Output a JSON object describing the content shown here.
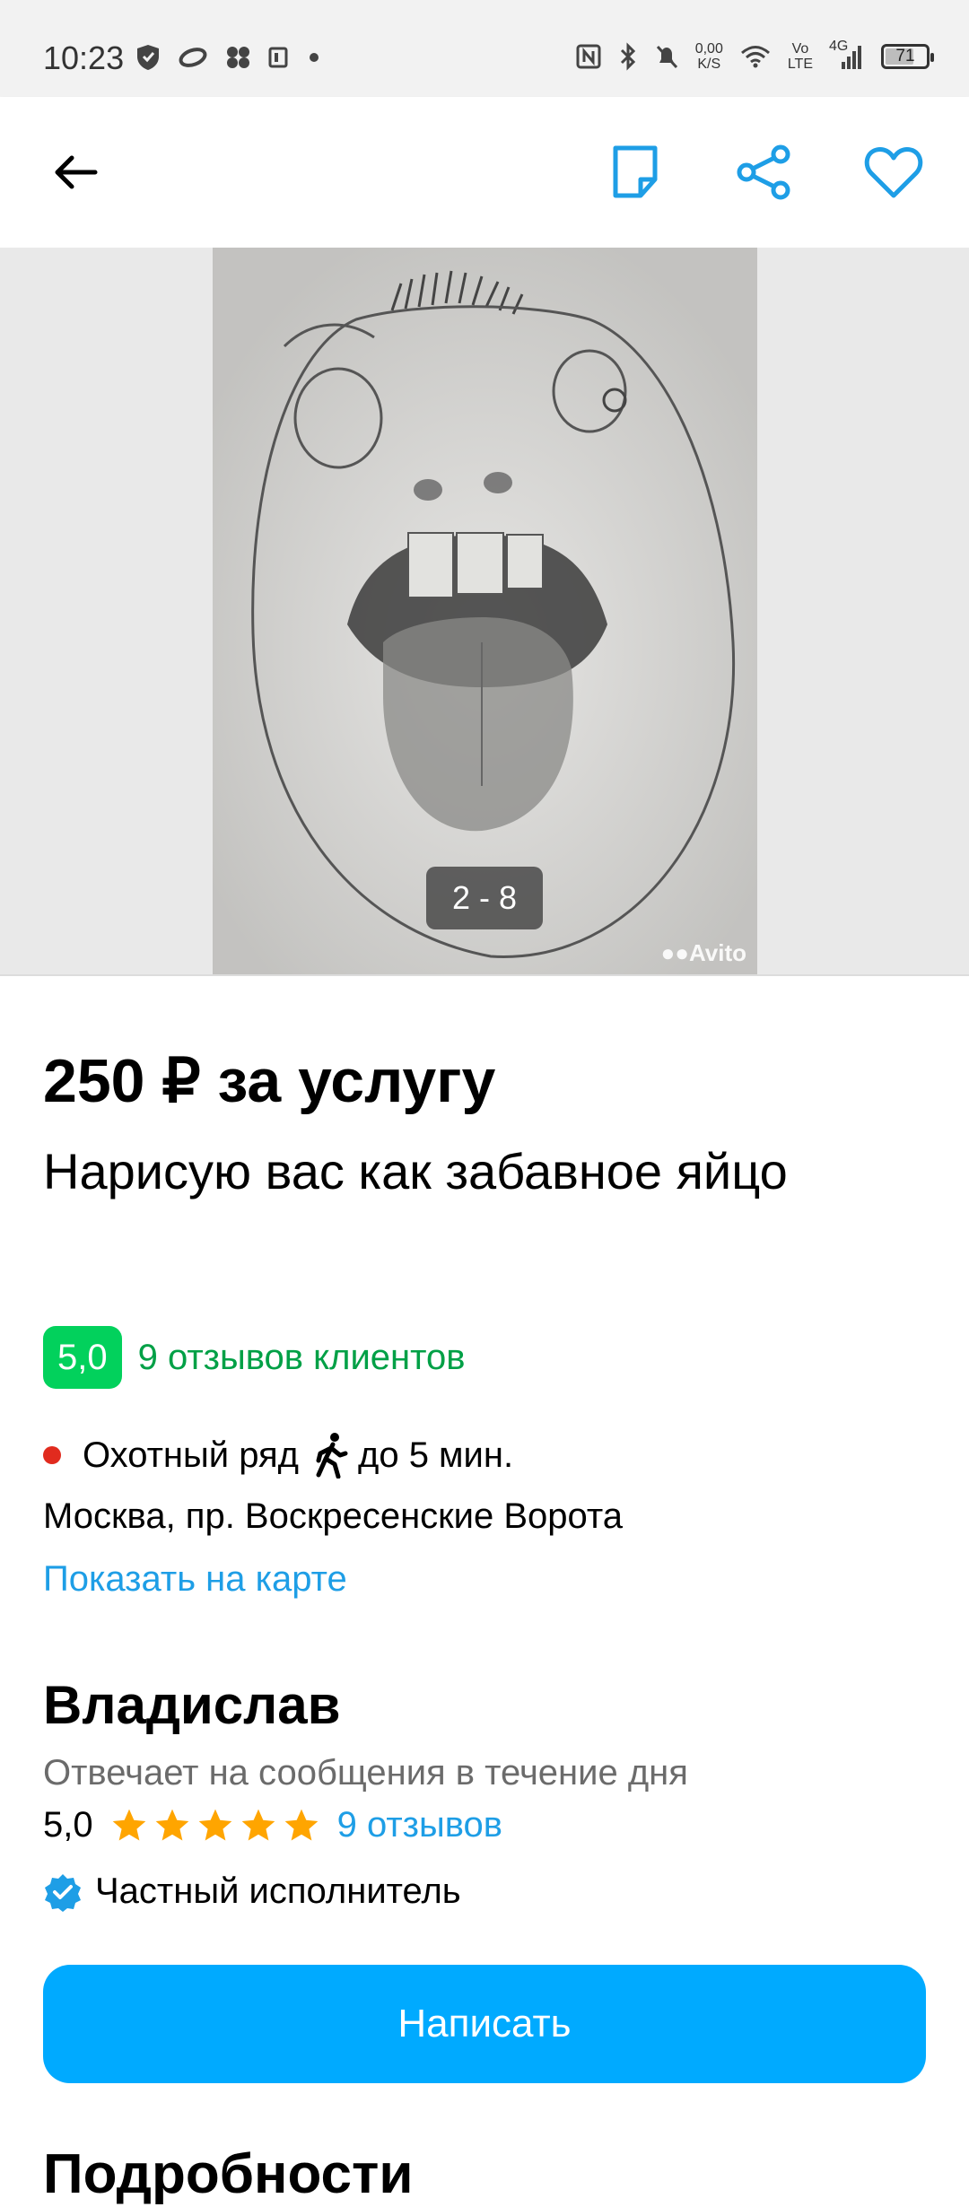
{
  "status_bar": {
    "time": "10:23",
    "net_speed_value": "0,00",
    "net_speed_unit": "K/S",
    "volte_top": "Vo",
    "volte_bottom": "LTE",
    "network": "4G",
    "battery_percent": "71",
    "battery_level": 0.71
  },
  "app_bar": {
    "icons": [
      "back-arrow-icon",
      "note-icon",
      "share-icon",
      "heart-icon"
    ]
  },
  "gallery": {
    "counter": "2 - 8",
    "watermark": "Avito"
  },
  "listing": {
    "price": "250 ₽ за услугу",
    "title": "Нарисую вас как забавное яйцо",
    "rating": "5,0",
    "reviews": "9 отзывов клиентов",
    "metro_station": "Охотный ряд",
    "walk_time": "до 5 мин.",
    "address": "Москва, пр. Воскресенские Ворота",
    "map_link": "Показать на карте"
  },
  "seller": {
    "name": "Владислав",
    "reply_time": "Отвечает на сообщения в течение дня",
    "rating": "5,0",
    "stars": 5,
    "reviews_link": "9 отзывов",
    "type": "Частный исполнитель"
  },
  "actions": {
    "write_button": "Написать"
  },
  "sections": {
    "details_heading": "Подробности"
  },
  "colors": {
    "accent_blue": "#00aaff",
    "link_blue": "#1e9ee6",
    "rating_green": "#02d15c",
    "reviews_green": "#00a046",
    "metro_red": "#e12b1e",
    "star_orange": "#ffa500"
  }
}
